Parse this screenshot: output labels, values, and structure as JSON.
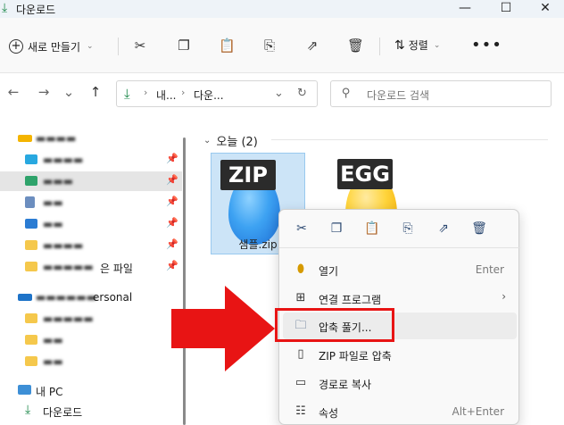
{
  "window": {
    "title": "다운로드",
    "controls": {
      "minimize": "—",
      "maximize": "☐",
      "close": "✕"
    }
  },
  "command_bar": {
    "new_label": "새로 만들기",
    "sort_label": "정렬",
    "more_label": "•••",
    "icons": [
      "cut-icon",
      "copy-icon",
      "paste-icon",
      "rename-icon",
      "share-icon",
      "delete-icon"
    ]
  },
  "navigation": {
    "breadcrumbs": [
      "내...",
      "다운..."
    ],
    "search_placeholder": "다운로드 검색"
  },
  "sidebar": {
    "items": [
      {
        "label": "▬▬▬▬"
      },
      {
        "label": "▬▬▬▬"
      },
      {
        "label": "▬▬▬"
      },
      {
        "label": "▬▬"
      },
      {
        "label": "▬▬"
      },
      {
        "label": "▬▬▬▬"
      },
      {
        "label": "▬▬▬▬▬",
        "suffix": "은 파일"
      },
      {
        "label": "▬▬▬▬▬▬",
        "suffix": "ersonal"
      },
      {
        "label": "▬▬▬▬▬"
      },
      {
        "label": "▬▬"
      },
      {
        "label": "▬▬"
      },
      {
        "label": "내 PC"
      },
      {
        "label": "다운로드"
      }
    ]
  },
  "content": {
    "group_label": "오늘 (2)",
    "files": [
      {
        "name": "샘플.zip",
        "tag": "ZIP",
        "egg_color": "#3da2f2"
      },
      {
        "name": "",
        "tag": "EGG",
        "egg_color": "#ffd43b"
      }
    ]
  },
  "context_menu": {
    "items": [
      {
        "label": "열기",
        "shortcut": "Enter"
      },
      {
        "label": "연결 프로그램",
        "shortcut": ""
      },
      {
        "label": "압축 풀기...",
        "shortcut": ""
      },
      {
        "label": "ZIP 파일로 압축",
        "shortcut": ""
      },
      {
        "label": "경로로 복사",
        "shortcut": ""
      },
      {
        "label": "속성",
        "shortcut": "Alt+Enter"
      }
    ],
    "highlight_color": "#e81414"
  }
}
